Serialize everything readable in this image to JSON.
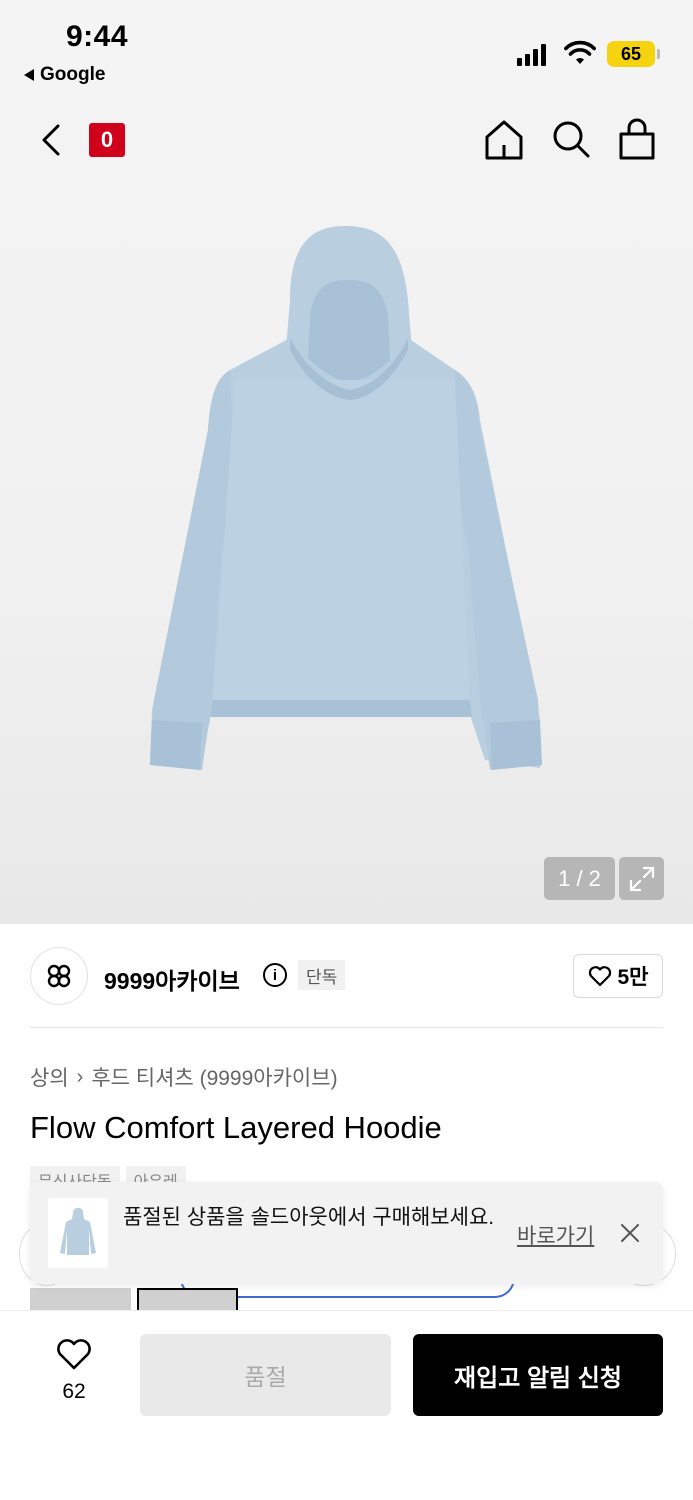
{
  "status_bar": {
    "time": "9:44",
    "back_app": "Google",
    "battery": "65"
  },
  "nav": {
    "logo": "0"
  },
  "gallery": {
    "pager": "1 / 2"
  },
  "brand": {
    "name": "9999아카이브",
    "info": "i",
    "exclusive": "단독",
    "likes": "5만"
  },
  "breadcrumb": {
    "category": "상의",
    "subcategory": "후드 티셔츠 (9999아카이브)"
  },
  "product": {
    "title": "Flow Comfort Layered Hoodie",
    "tags": [
      "무신사단독",
      "아우레"
    ]
  },
  "toast": {
    "message": "품절된 상품을 솔드아웃에서 구매해보세요.",
    "link": "바로가기"
  },
  "bottom": {
    "like_count": "62",
    "soldout_label": "품절",
    "restock_label": "재입고 알림 신청"
  },
  "colors": {
    "logo_red": "#d0021b",
    "battery_yellow": "#f5d40f",
    "primary_button": "#000000",
    "disabled_button": "#e9e9e9",
    "hoodie": "#b9cfe0"
  }
}
